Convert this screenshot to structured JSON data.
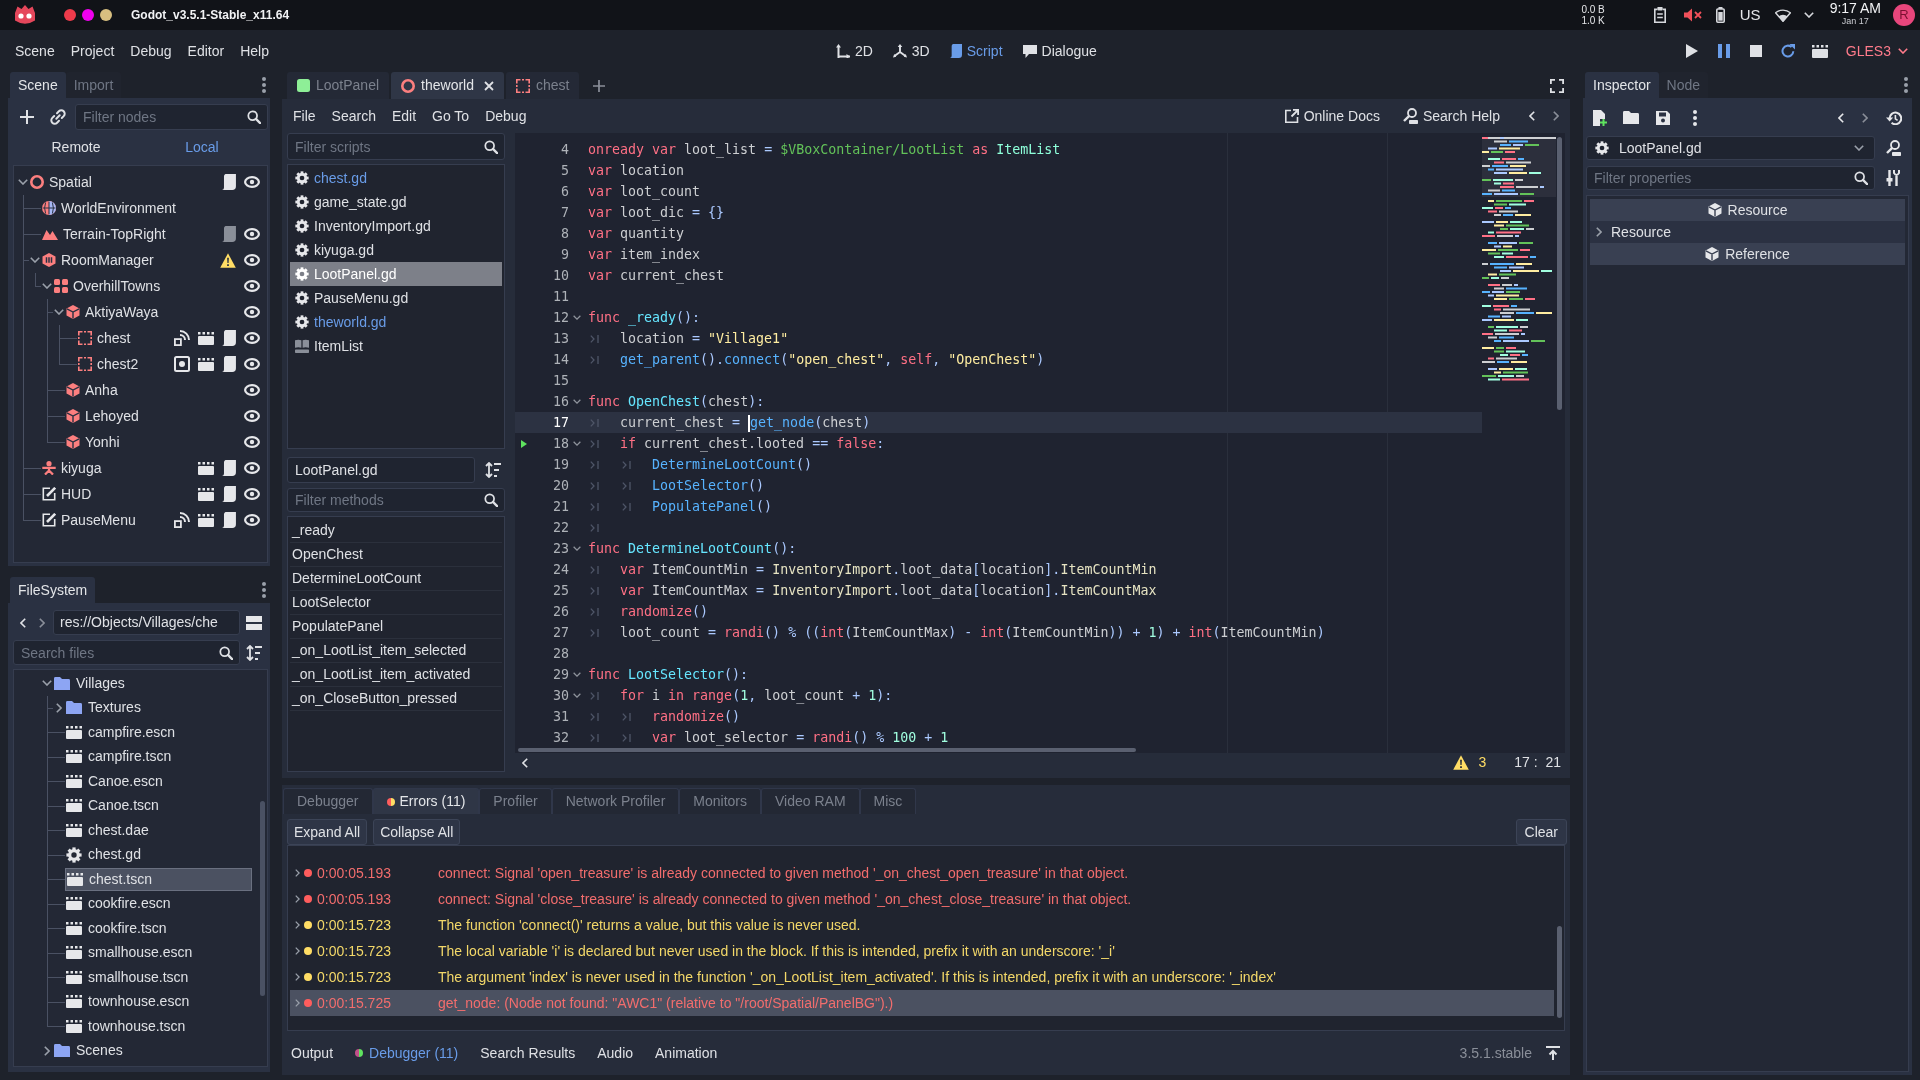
{
  "system_bar": {
    "title": "Godot_v3.5.1-Stable_x11.64",
    "network": [
      "0.0 B",
      "1.0 K"
    ],
    "keyboard": "US",
    "time": "9:17 AM",
    "date": "Jan 17",
    "avatar": "R"
  },
  "menu_bar": {
    "menus": [
      "Scene",
      "Project",
      "Debug",
      "Editor",
      "Help"
    ],
    "workspaces": [
      {
        "label": "2D",
        "kind": "canvas",
        "selected": false
      },
      {
        "label": "3D",
        "kind": "spatial",
        "selected": false
      },
      {
        "label": "Script",
        "kind": "script",
        "selected": true
      },
      {
        "label": "Dialogue",
        "kind": "dialogue",
        "selected": false
      }
    ],
    "renderer": "GLES3"
  },
  "scene_dock": {
    "tabs": [
      {
        "label": "Scene",
        "selected": true
      },
      {
        "label": "Import",
        "selected": false
      }
    ],
    "filter": {
      "placeholder": "Filter nodes"
    },
    "modes": [
      {
        "label": "Remote",
        "selected": false
      },
      {
        "label": "Local",
        "selected": true
      }
    ],
    "tree": [
      {
        "name": "Spatial",
        "kind": "spatial",
        "expanded": true,
        "visible": true,
        "buttons": [
          {
            "kind": "script"
          }
        ],
        "children": [
          {
            "name": "WorldEnvironment",
            "kind": "environment"
          },
          {
            "name": "Terrain-TopRight",
            "kind": "terrain",
            "visible": true,
            "buttons": [
              {
                "kind": "script_inherited"
              }
            ]
          },
          {
            "name": "RoomManager",
            "kind": "manager",
            "expanded": true,
            "visible": true,
            "buttons": [
              {
                "kind": "warning"
              }
            ],
            "children": [
              {
                "name": "OverhillTowns",
                "kind": "group",
                "expanded": true,
                "visible": true,
                "children": [
                  {
                    "name": "AktiyaWaya",
                    "kind": "room",
                    "expanded": true,
                    "visible": true,
                    "children": [
                      {
                        "name": "chest",
                        "kind": "portal",
                        "visible": true,
                        "buttons": [
                          {
                            "kind": "signals"
                          },
                          {
                            "kind": "scene"
                          },
                          {
                            "kind": "script"
                          }
                        ]
                      },
                      {
                        "name": "chest2",
                        "kind": "portal",
                        "visible": true,
                        "buttons": [
                          {
                            "kind": "groups"
                          },
                          {
                            "kind": "scene"
                          },
                          {
                            "kind": "script"
                          }
                        ]
                      }
                    ]
                  },
                  {
                    "name": "Anha",
                    "kind": "room",
                    "visible": true
                  },
                  {
                    "name": "Lehoyed",
                    "kind": "room",
                    "visible": true
                  },
                  {
                    "name": "Yonhi",
                    "kind": "room",
                    "visible": true
                  }
                ]
              }
            ]
          },
          {
            "name": "kiyuga",
            "kind": "character",
            "visible": true,
            "buttons": [
              {
                "kind": "scene"
              },
              {
                "kind": "script"
              }
            ]
          },
          {
            "name": "HUD",
            "kind": "control",
            "visible": true,
            "buttons": [
              {
                "kind": "scene"
              },
              {
                "kind": "script"
              }
            ]
          },
          {
            "name": "PauseMenu",
            "kind": "control",
            "visible": true,
            "buttons": [
              {
                "kind": "signals"
              },
              {
                "kind": "scene"
              },
              {
                "kind": "script"
              }
            ]
          }
        ]
      }
    ]
  },
  "filesystem_dock": {
    "tabs": [
      {
        "label": "FileSystem",
        "selected": true
      }
    ],
    "path": "res://Objects/Villages/che",
    "search": {
      "placeholder": "Search files"
    },
    "tree": [
      {
        "name": "Villages",
        "kind": "folder",
        "expanded": true,
        "selected": false,
        "children": [
          {
            "name": "Textures",
            "kind": "folder",
            "expanded": false,
            "selected": false
          },
          {
            "name": "campfire.escn",
            "kind": "scene",
            "selected": false
          },
          {
            "name": "campfire.tscn",
            "kind": "scene",
            "selected": false
          },
          {
            "name": "Canoe.escn",
            "kind": "scene",
            "selected": false
          },
          {
            "name": "Canoe.tscn",
            "kind": "scene",
            "selected": false
          },
          {
            "name": "chest.dae",
            "kind": "scene",
            "selected": false
          },
          {
            "name": "chest.gd",
            "kind": "script",
            "selected": false
          },
          {
            "name": "chest.tscn",
            "kind": "scene",
            "selected": true
          },
          {
            "name": "cookfire.escn",
            "kind": "scene",
            "selected": false
          },
          {
            "name": "cookfire.tscn",
            "kind": "scene",
            "selected": false
          },
          {
            "name": "smallhouse.escn",
            "kind": "scene",
            "selected": false
          },
          {
            "name": "smallhouse.tscn",
            "kind": "scene",
            "selected": false
          },
          {
            "name": "townhouse.escn",
            "kind": "scene",
            "selected": false
          },
          {
            "name": "townhouse.tscn",
            "kind": "scene",
            "selected": false
          }
        ]
      },
      {
        "name": "Scenes",
        "kind": "folder",
        "expanded": false,
        "selected": false
      }
    ]
  },
  "script_editor": {
    "scene_tabs": [
      {
        "label": "LootPanel",
        "kind": "panel",
        "selected": false
      },
      {
        "label": "theworld",
        "kind": "spatial",
        "selected": true
      },
      {
        "label": "chest",
        "kind": "portal",
        "selected": false
      }
    ],
    "menus": [
      "File",
      "Search",
      "Edit",
      "Go To",
      "Debug"
    ],
    "help": [
      {
        "label": "Online Docs",
        "kind": "docs"
      },
      {
        "label": "Search Help",
        "kind": "search"
      }
    ],
    "script_filter": {
      "placeholder": "Filter scripts"
    },
    "scripts": [
      {
        "name": "chest.gd",
        "kind": "script",
        "highlighted": true,
        "selected": false
      },
      {
        "name": "game_state.gd",
        "kind": "script",
        "highlighted": false,
        "selected": false
      },
      {
        "name": "InventoryImport.gd",
        "kind": "script",
        "highlighted": false,
        "selected": false
      },
      {
        "name": "kiyuga.gd",
        "kind": "script",
        "highlighted": false,
        "selected": false
      },
      {
        "name": "LootPanel.gd",
        "kind": "script",
        "highlighted": false,
        "selected": true
      },
      {
        "name": "PauseMenu.gd",
        "kind": "script",
        "highlighted": false,
        "selected": false
      },
      {
        "name": "theworld.gd",
        "kind": "script",
        "highlighted": true,
        "selected": false
      },
      {
        "name": "ItemList",
        "kind": "doc",
        "highlighted": false,
        "selected": false
      }
    ],
    "current_script": "LootPanel.gd",
    "method_filter": {
      "placeholder": "Filter methods"
    },
    "methods": [
      "_ready",
      "OpenChest",
      "DetermineLootCount",
      "LootSelector",
      "PopulatePanel",
      "_on_LootList_item_selected",
      "_on_LootList_item_activated",
      "_on_CloseButton_pressed"
    ],
    "lines": [
      {
        "number": "4",
        "fold": false,
        "current": false,
        "marker": false,
        "tokens": [
          {
            "kind": "kw",
            "text": "onready "
          },
          {
            "kind": "kw",
            "text": "var "
          },
          {
            "kind": "txt",
            "text": "loot_list "
          },
          {
            "kind": "sym",
            "text": "= "
          },
          {
            "kind": "path",
            "text": "$VBoxContainer/LootList "
          },
          {
            "kind": "kw",
            "text": "as "
          },
          {
            "kind": "type",
            "text": "ItemList"
          }
        ]
      },
      {
        "number": "5",
        "fold": false,
        "current": false,
        "marker": false,
        "tokens": [
          {
            "kind": "kw",
            "text": "var"
          },
          {
            "kind": "txt",
            "text": " location"
          }
        ]
      },
      {
        "number": "6",
        "fold": false,
        "current": false,
        "marker": false,
        "tokens": [
          {
            "kind": "kw",
            "text": "var"
          },
          {
            "kind": "txt",
            "text": " loot_count"
          }
        ]
      },
      {
        "number": "7",
        "fold": false,
        "current": false,
        "marker": false,
        "tokens": [
          {
            "kind": "kw",
            "text": "var"
          },
          {
            "kind": "txt",
            "text": " loot_dic "
          },
          {
            "kind": "sym",
            "text": "= {}"
          }
        ]
      },
      {
        "number": "8",
        "fold": false,
        "current": false,
        "marker": false,
        "tokens": [
          {
            "kind": "kw",
            "text": "var"
          },
          {
            "kind": "txt",
            "text": " quantity"
          }
        ]
      },
      {
        "number": "9",
        "fold": false,
        "current": false,
        "marker": false,
        "tokens": [
          {
            "kind": "kw",
            "text": "var"
          },
          {
            "kind": "txt",
            "text": " item_index"
          }
        ]
      },
      {
        "number": "10",
        "fold": false,
        "current": false,
        "marker": false,
        "tokens": [
          {
            "kind": "kw",
            "text": "var"
          },
          {
            "kind": "txt",
            "text": " current_chest"
          }
        ]
      },
      {
        "number": "11",
        "fold": false,
        "current": false,
        "marker": false
      },
      {
        "number": "12",
        "fold": true,
        "current": false,
        "marker": false,
        "tokens": [
          {
            "kind": "kw",
            "text": "func "
          },
          {
            "kind": "def",
            "text": "_ready"
          },
          {
            "kind": "sym",
            "text": "():"
          }
        ]
      },
      {
        "number": "13",
        "fold": false,
        "current": false,
        "marker": false,
        "tokens": [
          {
            "kind": "tab"
          },
          {
            "kind": "txt",
            "text": "location "
          },
          {
            "kind": "sym",
            "text": "= "
          },
          {
            "kind": "str",
            "text": "\"Village1\""
          }
        ]
      },
      {
        "number": "14",
        "fold": false,
        "current": false,
        "marker": false,
        "tokens": [
          {
            "kind": "tab"
          },
          {
            "kind": "fn",
            "text": "get_parent"
          },
          {
            "kind": "sym",
            "text": "()."
          },
          {
            "kind": "fn",
            "text": "connect"
          },
          {
            "kind": "sym",
            "text": "("
          },
          {
            "kind": "str",
            "text": "\"open_chest\""
          },
          {
            "kind": "sym",
            "text": ", "
          },
          {
            "kind": "kw",
            "text": "self"
          },
          {
            "kind": "sym",
            "text": ", "
          },
          {
            "kind": "str",
            "text": "\"OpenChest\""
          },
          {
            "kind": "sym",
            "text": ")"
          }
        ]
      },
      {
        "number": "15",
        "fold": false,
        "current": false,
        "marker": false
      },
      {
        "number": "16",
        "fold": true,
        "current": false,
        "marker": false,
        "tokens": [
          {
            "kind": "kw",
            "text": "func "
          },
          {
            "kind": "def",
            "text": "OpenChest"
          },
          {
            "kind": "sym",
            "text": "("
          },
          {
            "kind": "txt",
            "text": "chest"
          },
          {
            "kind": "sym",
            "text": "):"
          }
        ]
      },
      {
        "number": "17",
        "fold": false,
        "current": true,
        "marker": false,
        "tokens": [
          {
            "kind": "tab"
          },
          {
            "kind": "txt",
            "text": "current_chest "
          },
          {
            "kind": "sym",
            "text": "= "
          },
          {
            "kind": "caret"
          },
          {
            "kind": "fn",
            "text": "get_node"
          },
          {
            "kind": "sym",
            "text": "("
          },
          {
            "kind": "txt",
            "text": "chest"
          },
          {
            "kind": "sym",
            "text": ")"
          }
        ]
      },
      {
        "number": "18",
        "fold": true,
        "current": false,
        "marker": true,
        "tokens": [
          {
            "kind": "tab"
          },
          {
            "kind": "kw",
            "text": "if"
          },
          {
            "kind": "txt",
            "text": " current_chest.looted "
          },
          {
            "kind": "sym",
            "text": "== "
          },
          {
            "kind": "kw",
            "text": "false"
          },
          {
            "kind": "sym",
            "text": ":"
          }
        ]
      },
      {
        "number": "19",
        "fold": false,
        "current": false,
        "marker": false,
        "tokens": [
          {
            "kind": "tab"
          },
          {
            "kind": "tab"
          },
          {
            "kind": "fn",
            "text": "DetermineLootCount"
          },
          {
            "kind": "sym",
            "text": "()"
          }
        ]
      },
      {
        "number": "20",
        "fold": false,
        "current": false,
        "marker": false,
        "tokens": [
          {
            "kind": "tab"
          },
          {
            "kind": "tab"
          },
          {
            "kind": "fn",
            "text": "LootSelector"
          },
          {
            "kind": "sym",
            "text": "()"
          }
        ]
      },
      {
        "number": "21",
        "fold": false,
        "current": false,
        "marker": false,
        "tokens": [
          {
            "kind": "tab"
          },
          {
            "kind": "tab"
          },
          {
            "kind": "fn",
            "text": "PopulatePanel"
          },
          {
            "kind": "sym",
            "text": "()"
          }
        ]
      },
      {
        "number": "22",
        "fold": false,
        "current": false,
        "marker": false,
        "tokens": [
          {
            "kind": "tab"
          }
        ]
      },
      {
        "number": "23",
        "fold": true,
        "current": false,
        "marker": false,
        "tokens": [
          {
            "kind": "kw",
            "text": "func "
          },
          {
            "kind": "def",
            "text": "DetermineLootCount"
          },
          {
            "kind": "sym",
            "text": "():"
          }
        ]
      },
      {
        "number": "24",
        "fold": false,
        "current": false,
        "marker": false,
        "tokens": [
          {
            "kind": "tab"
          },
          {
            "kind": "kw",
            "text": "var"
          },
          {
            "kind": "txt",
            "text": " ItemCountMin "
          },
          {
            "kind": "sym",
            "text": "= "
          },
          {
            "kind": "member",
            "text": "InventoryImport"
          },
          {
            "kind": "sym",
            "text": "."
          },
          {
            "kind": "txt",
            "text": "loot_data"
          },
          {
            "kind": "sym",
            "text": "["
          },
          {
            "kind": "txt",
            "text": "location"
          },
          {
            "kind": "sym",
            "text": "]."
          },
          {
            "kind": "member",
            "text": "ItemCountMin"
          }
        ]
      },
      {
        "number": "25",
        "fold": false,
        "current": false,
        "marker": false,
        "tokens": [
          {
            "kind": "tab"
          },
          {
            "kind": "kw",
            "text": "var"
          },
          {
            "kind": "txt",
            "text": " ItemCountMax "
          },
          {
            "kind": "sym",
            "text": "= "
          },
          {
            "kind": "member",
            "text": "InventoryImport"
          },
          {
            "kind": "sym",
            "text": "."
          },
          {
            "kind": "txt",
            "text": "loot_data"
          },
          {
            "kind": "sym",
            "text": "["
          },
          {
            "kind": "txt",
            "text": "location"
          },
          {
            "kind": "sym",
            "text": "]."
          },
          {
            "kind": "member",
            "text": "ItemCountMax"
          }
        ]
      },
      {
        "number": "26",
        "fold": false,
        "current": false,
        "marker": false,
        "tokens": [
          {
            "kind": "tab"
          },
          {
            "kind": "kw",
            "text": "randomize"
          },
          {
            "kind": "sym",
            "text": "()"
          }
        ]
      },
      {
        "number": "27",
        "fold": false,
        "current": false,
        "marker": false,
        "tokens": [
          {
            "kind": "tab"
          },
          {
            "kind": "txt",
            "text": "loot_count "
          },
          {
            "kind": "sym",
            "text": "= "
          },
          {
            "kind": "kw",
            "text": "randi"
          },
          {
            "kind": "sym",
            "text": "() % (("
          },
          {
            "kind": "kw",
            "text": "int"
          },
          {
            "kind": "sym",
            "text": "("
          },
          {
            "kind": "txt",
            "text": "ItemCountMax"
          },
          {
            "kind": "sym",
            "text": ") - "
          },
          {
            "kind": "kw",
            "text": "int"
          },
          {
            "kind": "sym",
            "text": "("
          },
          {
            "kind": "txt",
            "text": "ItemCountMin"
          },
          {
            "kind": "sym",
            "text": ")) + "
          },
          {
            "kind": "num",
            "text": "1"
          },
          {
            "kind": "sym",
            "text": ") + "
          },
          {
            "kind": "kw",
            "text": "int"
          },
          {
            "kind": "sym",
            "text": "("
          },
          {
            "kind": "txt",
            "text": "ItemCountMin"
          },
          {
            "kind": "sym",
            "text": ")"
          }
        ]
      },
      {
        "number": "28",
        "fold": false,
        "current": false,
        "marker": false
      },
      {
        "number": "29",
        "fold": true,
        "current": false,
        "marker": false,
        "tokens": [
          {
            "kind": "kw",
            "text": "func "
          },
          {
            "kind": "def",
            "text": "LootSelector"
          },
          {
            "kind": "sym",
            "text": "():"
          }
        ]
      },
      {
        "number": "30",
        "fold": true,
        "current": false,
        "marker": false,
        "tokens": [
          {
            "kind": "tab"
          },
          {
            "kind": "kw",
            "text": "for"
          },
          {
            "kind": "txt",
            "text": " i "
          },
          {
            "kind": "kw",
            "text": "in "
          },
          {
            "kind": "kw",
            "text": "range"
          },
          {
            "kind": "sym",
            "text": "("
          },
          {
            "kind": "num",
            "text": "1"
          },
          {
            "kind": "sym",
            "text": ", "
          },
          {
            "kind": "txt",
            "text": "loot_count "
          },
          {
            "kind": "sym",
            "text": "+ "
          },
          {
            "kind": "num",
            "text": "1"
          },
          {
            "kind": "sym",
            "text": "):"
          }
        ]
      },
      {
        "number": "31",
        "fold": false,
        "current": false,
        "marker": false,
        "tokens": [
          {
            "kind": "tab"
          },
          {
            "kind": "tab"
          },
          {
            "kind": "kw",
            "text": "randomize"
          },
          {
            "kind": "sym",
            "text": "()"
          }
        ]
      },
      {
        "number": "32",
        "fold": false,
        "current": false,
        "marker": false,
        "tokens": [
          {
            "kind": "tab"
          },
          {
            "kind": "tab"
          },
          {
            "kind": "kw",
            "text": "var"
          },
          {
            "kind": "txt",
            "text": " loot_selector "
          },
          {
            "kind": "sym",
            "text": "= "
          },
          {
            "kind": "kw",
            "text": "randi"
          },
          {
            "kind": "sym",
            "text": "() % "
          },
          {
            "kind": "num",
            "text": "100"
          },
          {
            "kind": "sym",
            "text": " + "
          },
          {
            "kind": "num",
            "text": "1"
          }
        ]
      }
    ],
    "warnings": "3",
    "position": "17 :  21"
  },
  "bottom_panel": {
    "tabs": [
      {
        "label": "Debugger",
        "selected": false
      },
      {
        "label": "Errors (11)",
        "selected": true,
        "dot": true
      },
      {
        "label": "Profiler",
        "selected": false
      },
      {
        "label": "Network Profiler",
        "selected": false
      },
      {
        "label": "Monitors",
        "selected": false
      },
      {
        "label": "Video RAM",
        "selected": false
      },
      {
        "label": "Misc",
        "selected": false
      }
    ],
    "buttons": [
      "Expand All",
      "Collapse All"
    ],
    "clear": "Clear",
    "messages": [
      {
        "kind": "error",
        "time": "0:00:05.193",
        "text": "connect: Signal 'open_treasure' is already connected to given method '_on_chest_open_treasure' in that object.",
        "selected": false
      },
      {
        "kind": "error",
        "time": "0:00:05.193",
        "text": "connect: Signal 'close_treasure' is already connected to given method '_on_chest_close_treasure' in that object.",
        "selected": false
      },
      {
        "kind": "warning",
        "time": "0:00:15.723",
        "text": "The function 'connect()' returns a value, but this value is never used.",
        "selected": false
      },
      {
        "kind": "warning",
        "time": "0:00:15.723",
        "text": "The local variable 'i' is declared but never used in the block. If this is intended, prefix it with an underscore: '_i'",
        "selected": false
      },
      {
        "kind": "warning",
        "time": "0:00:15.723",
        "text": "The argument 'index' is never used in the function '_on_LootList_item_activated'. If this is intended, prefix it with an underscore: '_index'",
        "selected": false
      },
      {
        "kind": "error",
        "time": "0:00:15.725",
        "text": "get_node: (Node not found: \"AWC1\" (relative to \"/root/Spatial/PanelBG\").)",
        "selected": true
      }
    ],
    "panels": [
      {
        "label": "Output",
        "selected": false
      },
      {
        "label": "Debugger (11)",
        "selected": true,
        "dot": true
      },
      {
        "label": "Search Results",
        "selected": false
      },
      {
        "label": "Audio",
        "selected": false
      },
      {
        "label": "Animation",
        "selected": false
      }
    ],
    "version": "3.5.1.stable"
  },
  "inspector": {
    "tabs": [
      {
        "label": "Inspector",
        "selected": true
      },
      {
        "label": "Node",
        "selected": false
      }
    ],
    "object": "LootPanel.gd",
    "filter": {
      "placeholder": "Filter properties"
    },
    "sections": [
      {
        "kind": "category",
        "label": "Resource"
      },
      {
        "kind": "group",
        "label": "Resource",
        "expanded": false
      },
      {
        "kind": "category",
        "label": "Reference"
      }
    ]
  }
}
